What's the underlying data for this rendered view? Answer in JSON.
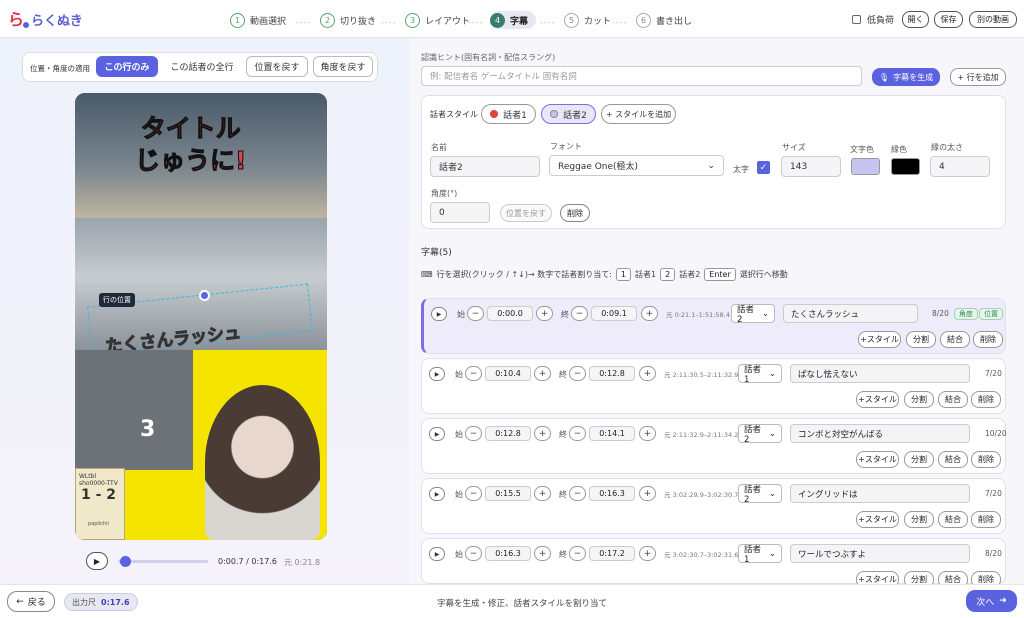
{
  "app": {
    "name": "らくぬき"
  },
  "steps": [
    {
      "num": "1",
      "label": "動画選択",
      "state": "done"
    },
    {
      "num": "2",
      "label": "切り抜き",
      "state": "done"
    },
    {
      "num": "3",
      "label": "レイアウト",
      "state": "done"
    },
    {
      "num": "4",
      "label": "字幕",
      "state": "active"
    },
    {
      "num": "5",
      "label": "カット",
      "state": "todo"
    },
    {
      "num": "6",
      "label": "書き出し",
      "state": "todo"
    }
  ],
  "header": {
    "low_load": "低負荷",
    "open": "開く",
    "save": "保存",
    "other_video": "別の動画"
  },
  "apply": {
    "label": "位置・角度の適用",
    "this_row": "この行のみ",
    "all_rows": "この話者の全行",
    "reset_pos": "位置を戻す",
    "reset_angle": "角度を戻す"
  },
  "video": {
    "title_line1": "タイトル",
    "title_line2": "じゅうに!",
    "subtitle": "たくさんラッシュ",
    "box_label": "行の位置",
    "card_line1": "WLtbl",
    "card_line2": "sho0000-TTV",
    "card_score": "1 - 2",
    "card_player": "papiichii",
    "overlay_num": "3",
    "time": "0:00.7 / 0:17.6",
    "orig": "元 0:21.8",
    "progress": 0.04
  },
  "hint": {
    "label": "認識ヒント(固有名詞・配信スラング)",
    "placeholder": "例: 配信者名 ゲームタイトル 固有名詞",
    "generate": "字幕を生成",
    "add_row": "+ 行を追加"
  },
  "style": {
    "title": "話者スタイル",
    "speakers": [
      {
        "label": "話者1",
        "color": "#e04040"
      },
      {
        "label": "話者2",
        "color": "#c8c4f0"
      }
    ],
    "add_style": "+ スタイルを追加",
    "name_label": "名前",
    "name_value": "話者2",
    "font_label": "フォント",
    "font_value": "Reggae One(極太)",
    "bold_label": "太字",
    "size_label": "サイズ",
    "size_value": "143",
    "color_label": "文字色",
    "text_color": "#c8c4f0",
    "edge_label": "縁色",
    "edge_color": "#000000",
    "edge_width_label": "縁の太さ",
    "edge_width_value": "4",
    "angle_label": "角度(°)",
    "angle_value": "0",
    "reset_pos": "位置を戻す",
    "delete": "削除"
  },
  "captions": {
    "title": "字幕(5)",
    "key_hint_1": "行を選択(クリック / ↑↓)→ 数字で話者割り当て:",
    "k1": "1",
    "k1_label": "話者1",
    "k2": "2",
    "k2_label": "話者2",
    "enter": "Enter",
    "enter_label": "選択行へ移動",
    "start_label": "始",
    "end_label": "終",
    "add_style": "+スタイル",
    "split": "分割",
    "merge": "結合",
    "delete": "削除",
    "rows": [
      {
        "start": "0:00.0",
        "end": "0:09.1",
        "orig": "元 0:21.1–1:51:58.4",
        "speaker": "話者2",
        "text": "たくさんラッシュ",
        "count": "8/20",
        "tag1": "角度",
        "tag2": "位置"
      },
      {
        "start": "0:10.4",
        "end": "0:12.8",
        "orig": "元 2:11:30.5–2:11:32.9",
        "speaker": "話者1",
        "text": "ぱなし怯えない",
        "count": "7/20"
      },
      {
        "start": "0:12.8",
        "end": "0:14.1",
        "orig": "元 2:11:32.9–2:11:34.2",
        "speaker": "話者2",
        "text": "コンボと対空がんばる",
        "count": "10/20"
      },
      {
        "start": "0:15.5",
        "end": "0:16.3",
        "orig": "元 3:02:29.9–3:02:30.7",
        "speaker": "話者2",
        "text": "イングリッドは",
        "count": "7/20"
      },
      {
        "start": "0:16.3",
        "end": "0:17.2",
        "orig": "元 3:02:30.7–3:02:31.6",
        "speaker": "話者1",
        "text": "ワールでつぶすよ",
        "count": "8/20"
      }
    ]
  },
  "footer": {
    "back": "戻る",
    "out_label": "出力尺",
    "out_value": "0:17.6",
    "message": "字幕を生成・修正、話者スタイルを割り当て",
    "next": "次へ"
  },
  "colors": {
    "accent": "#5b62e0",
    "step_done": "#5aa36a",
    "step_active": "#3a7d6e"
  }
}
